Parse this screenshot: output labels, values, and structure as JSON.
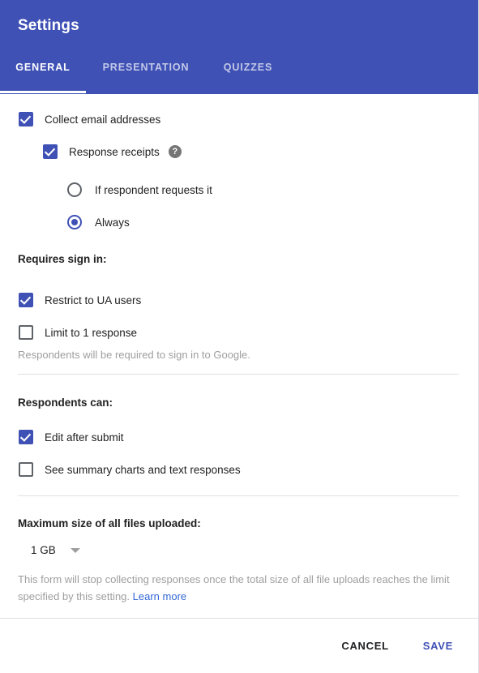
{
  "header": {
    "title": "Settings",
    "tabs": [
      {
        "label": "GENERAL",
        "active": true
      },
      {
        "label": "PRESENTATION",
        "active": false
      },
      {
        "label": "QUIZZES",
        "active": false
      }
    ]
  },
  "main": {
    "collect_email": {
      "label": "Collect email addresses",
      "checked": true
    },
    "response_receipts": {
      "label": "Response receipts",
      "checked": true,
      "help_icon": "help-icon",
      "help_glyph": "?",
      "options": [
        {
          "label": "If respondent requests it",
          "selected": false
        },
        {
          "label": "Always",
          "selected": true
        }
      ]
    },
    "requires_sign_in": {
      "heading": "Requires sign in:",
      "items": [
        {
          "label": "Restrict to UA users",
          "checked": true
        },
        {
          "label": "Limit to 1 response",
          "checked": false
        }
      ],
      "helper": "Respondents will be required to sign in to Google."
    },
    "respondents_can": {
      "heading": "Respondents can:",
      "items": [
        {
          "label": "Edit after submit",
          "checked": true
        },
        {
          "label": "See summary charts and text responses",
          "checked": false
        }
      ]
    },
    "max_file_size": {
      "heading": "Maximum size of all files uploaded:",
      "selected_value": "1 GB",
      "dropdown_icon": "chevron-down-icon",
      "helper_line_1": "This form will stop collecting responses once the total size of all file uploads reaches",
      "helper_line_2": "the limit specified by this setting.",
      "learn_more_label": "Learn more"
    }
  },
  "footer": {
    "cancel_label": "CANCEL",
    "save_label": "SAVE"
  },
  "colors": {
    "header_bg": "#3f51b5",
    "accent": "#3f51b5",
    "link": "#3367d6",
    "helper_text": "#9e9e9e",
    "divider": "#e0e0e0"
  }
}
